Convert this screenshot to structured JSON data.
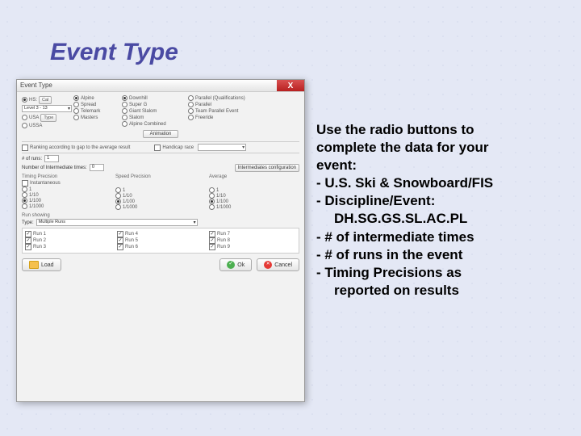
{
  "title": "Event Type",
  "window_title": "Event Type",
  "col1": {
    "items": [
      "HS:",
      "USA",
      "USSA"
    ],
    "type_btn": "Type",
    "cal_btn": "Cal",
    "sel": "Level 3 - 13"
  },
  "col2": {
    "items": [
      "Alpine",
      "Spread",
      "Telemark",
      "Masters"
    ]
  },
  "col3": {
    "items": [
      "Downhill",
      "Super G",
      "Giant Slalom",
      "Slalom",
      "Alpine Combined"
    ]
  },
  "col4": {
    "items": [
      "Parallel (Qualifications)",
      "Parallel",
      "Team Parallel Event",
      "Freeride"
    ]
  },
  "anim_btn": "Animation",
  "rank_cb": "Ranking according to gap to the average result",
  "hand_cb": "Handicap race",
  "runs_label": "# of runs:",
  "runs_val": "1",
  "inter_label": "Number of Intermediate times:",
  "inter_val": "0",
  "inter_btn": "Intermediates configuration",
  "grp_tp": "Timing Precision",
  "grp_sp": "Speed Precision",
  "grp_av": "Average",
  "prec": [
    "1",
    "1/10",
    "1/100",
    "1/1000"
  ],
  "grp_rw": "Run showing",
  "type_label": "Type:",
  "type_val": "Multiple Runs",
  "runs_checks": [
    "Run 1",
    "Run 2",
    "Run 3",
    "Run 4",
    "Run 5",
    "Run 6",
    "Run 7",
    "Run 8",
    "Run 9"
  ],
  "btn_load": "Load",
  "btn_ok": "Ok",
  "btn_cancel": "Cancel",
  "instr": {
    "l1": "Use the radio buttons to",
    "l2": "complete the data for your",
    "l3": "event:",
    "l4": "- U.S. Ski & Snowboard/FIS",
    "l5": "- Discipline/Event:",
    "l6": "DH.SG.GS.SL.AC.PL",
    "l7": "- # of intermediate times",
    "l8": "- # of runs in the event",
    "l9": "- Timing Precisions as",
    "l10": "reported on results"
  }
}
